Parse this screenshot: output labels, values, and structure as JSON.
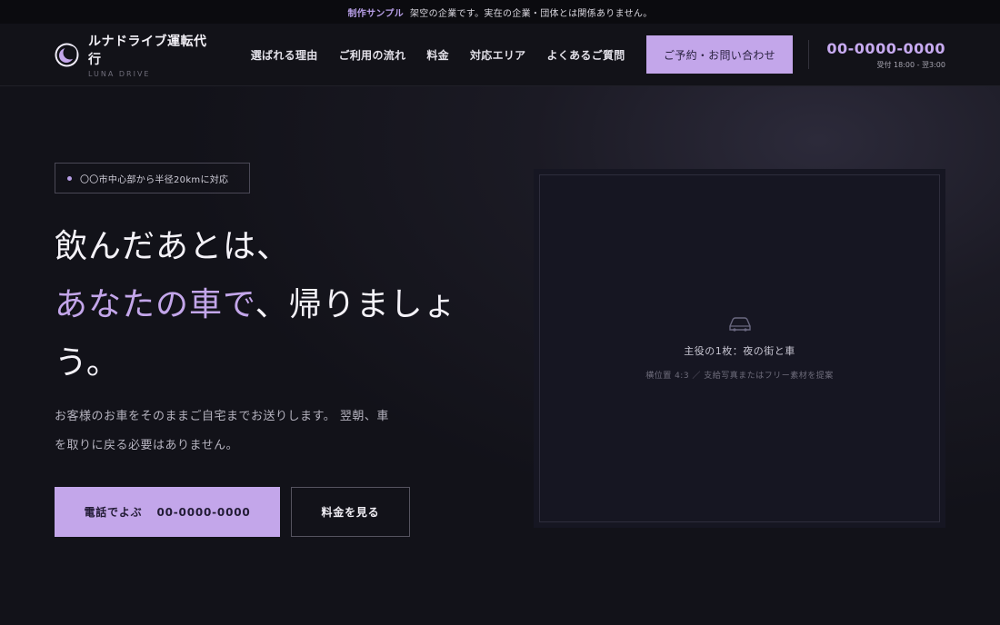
{
  "topbar": {
    "label": "制作サンプル",
    "notice": "架空の企業です。実在の企業・団体とは関係ありません。"
  },
  "brand": {
    "name": "ルナドライブ運転代行",
    "sub": "LUNA DRIVE",
    "logo_icon": "crescent-moon-icon",
    "accent_color": "#c3a6ea"
  },
  "nav": {
    "items": [
      {
        "label": "選ばれる理由"
      },
      {
        "label": "ご利用の流れ"
      },
      {
        "label": "料金"
      },
      {
        "label": "対応エリア"
      },
      {
        "label": "よくあるご質問"
      }
    ],
    "cta_label": "ご予約・お問い合わせ"
  },
  "contact": {
    "phone": "00-0000-0000",
    "hours": "受付 18:00 - 翌3:00"
  },
  "hero": {
    "badge": "〇〇市中心部から半径20kmに対応",
    "headline_line1": "飲んだあとは、",
    "headline_accent": "あなたの車で",
    "headline_rest": "、帰りましょう。",
    "lead": "お客様のお車をそのままご自宅までお送りします。 翌朝、車を取りに戻る必要はありません。",
    "call_label": "電話でよぶ",
    "call_number": "00-0000-0000",
    "price_label": "料金を見る"
  },
  "photo": {
    "icon": "car-icon",
    "title": "主役の1枚：夜の街と車",
    "note": "横位置 4:3 ／ 支給写真またはフリー素材を提案"
  }
}
